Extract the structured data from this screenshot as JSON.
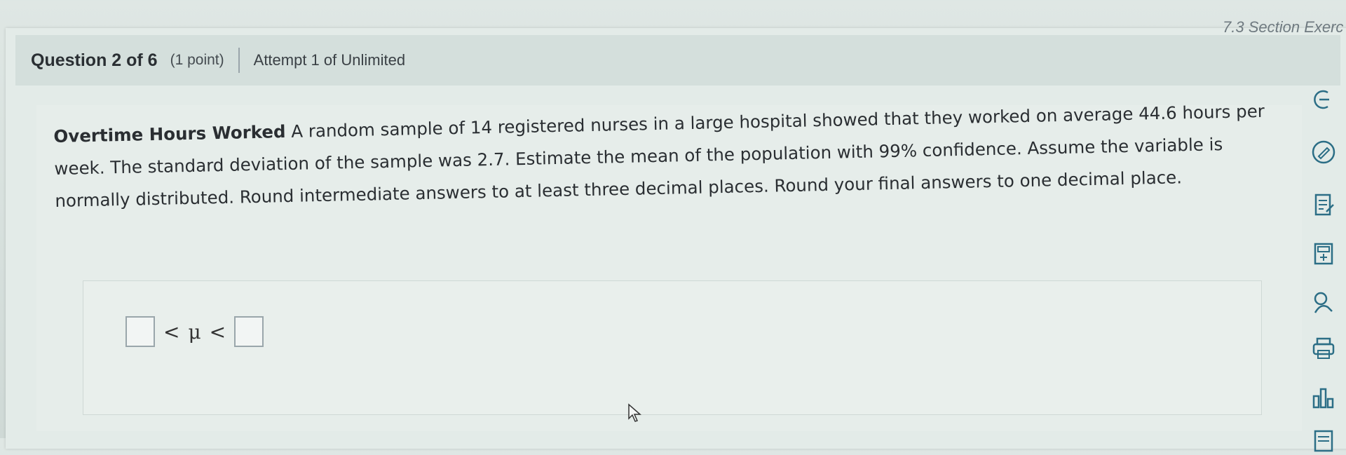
{
  "section_title": "7.3 Section Exerc",
  "question": {
    "number_label": "Question 2 of 6",
    "points_label": "(1 point)",
    "attempt_label": "Attempt 1 of Unlimited"
  },
  "problem": {
    "title": "Overtime Hours Worked",
    "text": "A random sample of 14 registered nurses in a large hospital showed that they worked on average 44.6 hours per week. The standard deviation of the sample was 2.7. Estimate the mean of the population with 99% confidence. Assume the variable is normally distributed. Round intermediate answers to at least three decimal places. Round your final answers to one decimal place."
  },
  "answer": {
    "lt1": "<",
    "mu": "μ",
    "lt2": "<"
  },
  "rail_icons": [
    "expand-icon",
    "edit-icon",
    "notes-icon",
    "calculator-icon",
    "help-icon",
    "print-icon",
    "stats-icon",
    "document-icon"
  ],
  "colors": {
    "accent": "#2c6e86",
    "header_bg": "#d4dfdc",
    "page_bg": "#e3ebe8"
  }
}
